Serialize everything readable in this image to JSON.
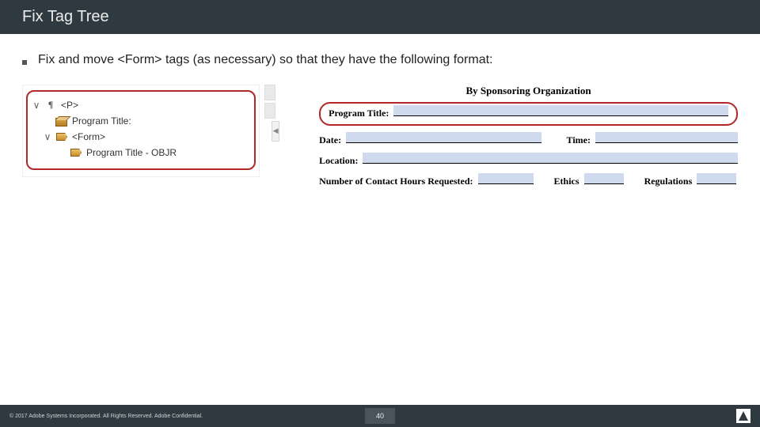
{
  "title": "Fix Tag Tree",
  "bullet": "Fix and move <Form> tags (as necessary) so that they have the following format:",
  "tree": {
    "p_tag": "<P>",
    "program_title_label": "Program Title:",
    "form_tag": "<Form>",
    "objr_label": "Program Title - OBJR"
  },
  "form": {
    "heading": "By Sponsoring Organization",
    "program_title": "Program Title:",
    "date": "Date:",
    "time": "Time:",
    "location": "Location:",
    "hours": "Number of Contact Hours Requested:",
    "ethics": "Ethics",
    "regulations": "Regulations"
  },
  "footer": {
    "copyright": "© 2017 Adobe Systems Incorporated.  All Rights Reserved.  Adobe Confidential.",
    "page": "40"
  }
}
